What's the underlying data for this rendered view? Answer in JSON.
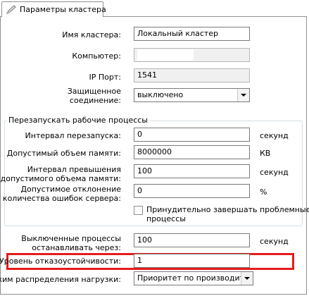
{
  "tab": {
    "label": "Параметры кластера"
  },
  "fields": {
    "cluster_name": {
      "label": "Имя кластера:",
      "value": "Локальный кластер"
    },
    "computer": {
      "label": "Компьютер:",
      "value": ""
    },
    "ip_port": {
      "label": "IP Порт:",
      "value": "1541"
    },
    "secure_connection": {
      "label_line1": "Защищенное",
      "label_line2": "соединение:",
      "value": "выключено"
    }
  },
  "restart_group": {
    "title": "Перезапускать рабочие процессы",
    "restart_interval": {
      "label": "Интервал перезапуска:",
      "value": "0",
      "unit": "секунд"
    },
    "memory_limit": {
      "label": "Допустимый объем памяти:",
      "value": "8000000",
      "unit": "КВ"
    },
    "memory_exceed_interval": {
      "label_line1": "Интервал превышения",
      "label_line2": "допустимого объема памяти:",
      "value": "100",
      "unit": "секунд"
    },
    "server_error_deviation": {
      "label_line1": "Допустимое отклонение",
      "label_line2": "количества ошибок сервера:",
      "value": "0",
      "unit": "%"
    },
    "force_terminate": {
      "label_line1": "Принудительно завершать проблемные",
      "label_line2": "процессы",
      "checked": false
    }
  },
  "stop_disabled": {
    "label_line1": "Выключенные процессы",
    "label_line2": "останавливать через:",
    "value": "100",
    "unit": "секунд"
  },
  "fault_tolerance": {
    "label": "Уровень отказоустойчивости:",
    "value": "1"
  },
  "load_balancing": {
    "label": "Режим распределения нагрузки:",
    "value": "Приоритет по производительности"
  },
  "colors": {
    "highlight": "#e51b1b",
    "border": "#7a7a7a"
  }
}
